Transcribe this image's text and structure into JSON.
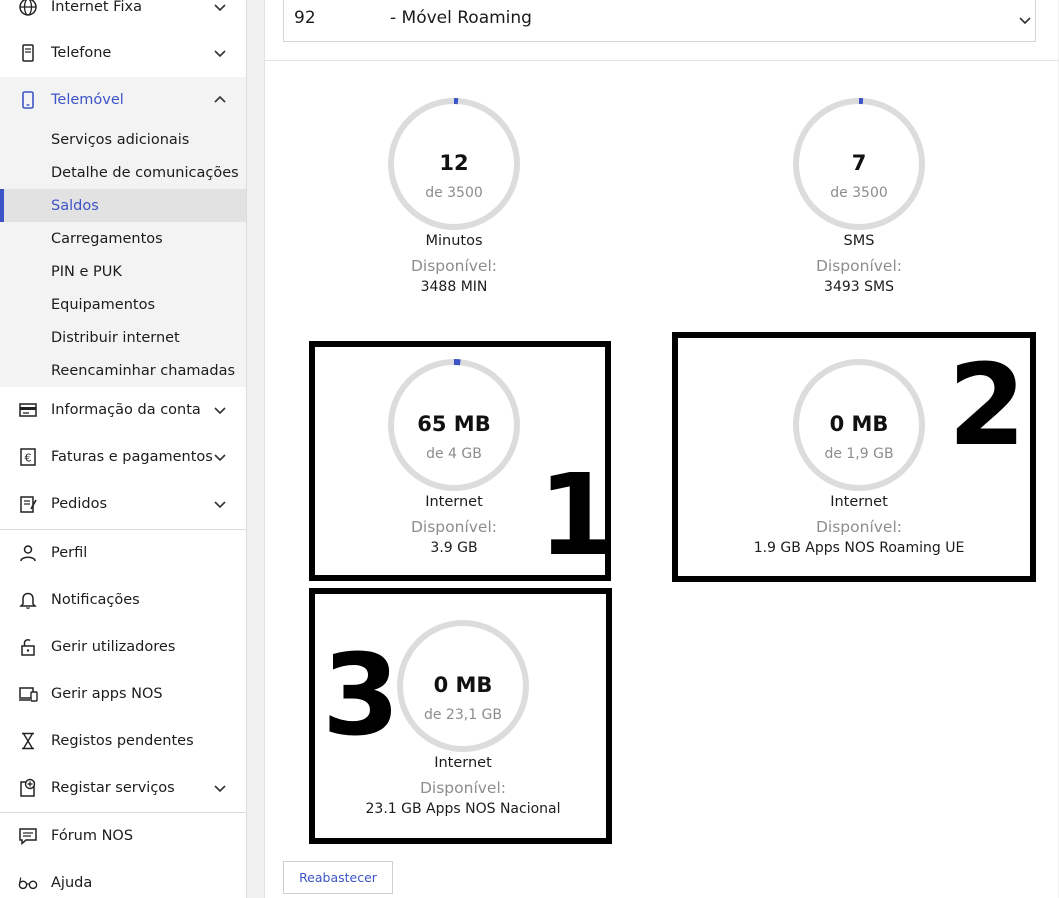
{
  "sidebar": {
    "items": [
      {
        "label": "Internet Fixa",
        "icon": "globe-icon"
      },
      {
        "label": "Telefone",
        "icon": "phone-icon"
      },
      {
        "label": "Telemóvel",
        "icon": "mobile-icon"
      },
      {
        "label": "Informação da conta",
        "icon": "account-card-icon"
      },
      {
        "label": "Faturas e pagamentos",
        "icon": "euro-icon"
      },
      {
        "label": "Pedidos",
        "icon": "orders-icon"
      },
      {
        "label": "Perfil",
        "icon": "user-icon"
      },
      {
        "label": "Notificações",
        "icon": "bell-icon"
      },
      {
        "label": "Gerir utilizadores",
        "icon": "lock-open-icon"
      },
      {
        "label": "Gerir apps NOS",
        "icon": "devices-icon"
      },
      {
        "label": "Registos pendentes",
        "icon": "hourglass-icon"
      },
      {
        "label": "Registar serviços",
        "icon": "add-service-icon"
      },
      {
        "label": "Fórum NOS",
        "icon": "chat-icon"
      },
      {
        "label": "Ajuda",
        "icon": "glasses-icon"
      }
    ],
    "subitems": [
      "Serviços adicionais",
      "Detalhe de comunicações",
      "Saldos",
      "Carregamentos",
      "PIN e PUK",
      "Equipamentos",
      "Distribuir internet",
      "Reencaminhar chamadas"
    ],
    "selected_subitem": "Saldos"
  },
  "line_select": {
    "number": "92",
    "name": "- Móvel Roaming"
  },
  "balances": [
    {
      "value": "12",
      "total": "de 3500",
      "label": "Minutos",
      "available_label": "Disponível:",
      "available": "3488 MIN",
      "used_fraction": 0.0034
    },
    {
      "value": "7",
      "total": "de 3500",
      "label": "SMS",
      "available_label": "Disponível:",
      "available": "3493 SMS",
      "used_fraction": 0.002
    },
    {
      "value": "65 MB",
      "total": "de 4 GB",
      "label": "Internet",
      "available_label": "Disponível:",
      "available": "3.9 GB",
      "used_fraction": 0.016
    },
    {
      "value": "0 MB",
      "total": "de 1,9 GB",
      "label": "Internet",
      "available_label": "Disponível:",
      "available": "1.9 GB Apps NOS Roaming UE",
      "used_fraction": 0
    },
    {
      "value": "0 MB",
      "total": "de 23,1 GB",
      "label": "Internet",
      "available_label": "Disponível:",
      "available": "23.1 GB Apps NOS Nacional",
      "used_fraction": 0
    }
  ],
  "annotations": [
    "1",
    "2",
    "3"
  ],
  "reabastecer_label": "Reabastecer",
  "colors": {
    "accent": "#3d54c8",
    "ring_track": "#dcdcdc",
    "annotation": "#000000"
  }
}
